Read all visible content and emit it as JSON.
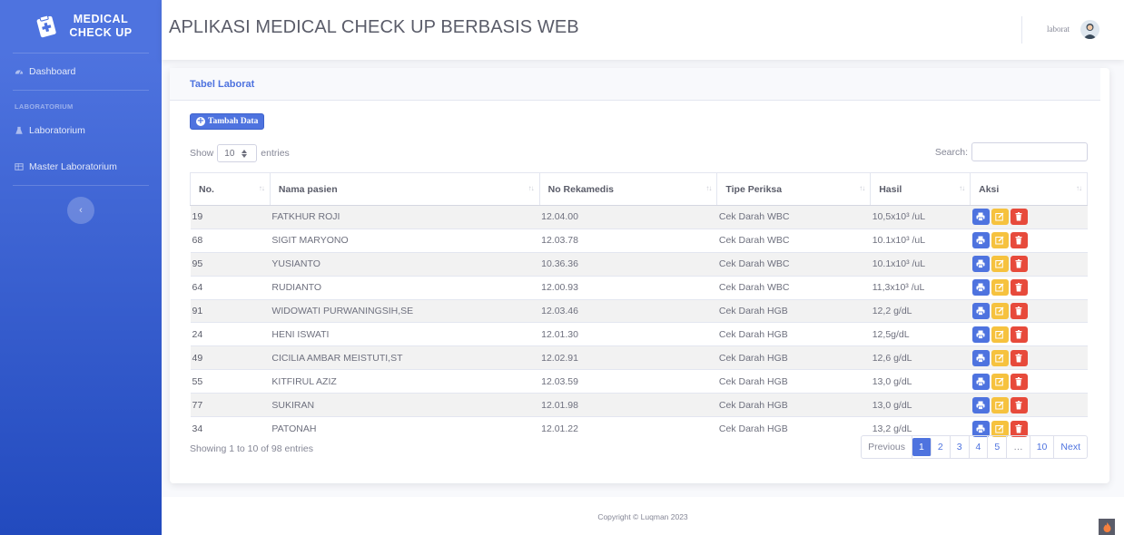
{
  "sidebar": {
    "brand_line1": "MEDICAL",
    "brand_line2": "CHECK UP",
    "dashboard_label": "Dashboard",
    "heading_laboratorium": "LABORATORIUM",
    "laboratorium_label": "Laboratorium",
    "master_label": "Master Laboratorium",
    "toggle_glyph": "‹"
  },
  "topbar": {
    "title": "APLIKASI MEDICAL CHECK UP BERBASIS WEB",
    "user_name": "laborat"
  },
  "card": {
    "title": "Tabel Laborat",
    "add_button": "Tambah Data",
    "show_label": "Show",
    "show_value": "10",
    "entries_label": "entries",
    "search_label": "Search:",
    "search_value": ""
  },
  "table": {
    "columns": [
      "No.",
      "Nama pasien",
      "No Rekamedis",
      "Tipe Periksa",
      "Hasil",
      "Aksi"
    ],
    "rows": [
      [
        "19",
        "FATKHUR ROJI",
        "12.04.00",
        "Cek Darah WBC",
        "10,5x10³ /uL"
      ],
      [
        "68",
        "SIGIT MARYONO",
        "12.03.78",
        "Cek Darah WBC",
        "10.1x10³ /uL"
      ],
      [
        "95",
        "YUSIANTO",
        "10.36.36",
        "Cek Darah WBC",
        "10.1x10³ /uL"
      ],
      [
        "64",
        "RUDIANTO",
        "12.00.93",
        "Cek Darah WBC",
        "11,3x10³ /uL"
      ],
      [
        "91",
        "WIDOWATI PURWANINGSIH,SE",
        "12.03.46",
        "Cek Darah HGB",
        "12,2 g/dL"
      ],
      [
        "24",
        "HENI ISWATI",
        "12.01.30",
        "Cek Darah HGB",
        "12,5g/dL"
      ],
      [
        "49",
        "CICILIA AMBAR MEISTUTI,ST",
        "12.02.91",
        "Cek Darah HGB",
        "12,6 g/dL"
      ],
      [
        "55",
        "KITFIRUL AZIZ",
        "12.03.59",
        "Cek Darah HGB",
        "13,0 g/dL"
      ],
      [
        "77",
        "SUKIRAN",
        "12.01.98",
        "Cek Darah HGB",
        "13,0 g/dL"
      ],
      [
        "34",
        "PATONAH",
        "12.01.22",
        "Cek Darah HGB",
        "13,2 g/dL"
      ]
    ]
  },
  "info": "Showing 1 to 10 of 98 entries",
  "pagination": {
    "previous": "Previous",
    "pages": [
      "1",
      "2",
      "3",
      "4",
      "5",
      "…",
      "10"
    ],
    "active_page": "1",
    "next": "Next"
  },
  "footer": "Copyright © Luqman 2023",
  "icons": {
    "brand": "notes-medical-icon",
    "dashboard": "tachometer-icon",
    "laboratorium": "flask-icon",
    "master": "table-icon",
    "add": "plus-circle-icon",
    "print": "print-icon",
    "edit": "edit-icon",
    "delete": "trash-icon",
    "scroll_top": "fire-icon"
  },
  "colors": {
    "primary": "#4e73df",
    "warning": "#f6c23e",
    "danger": "#e74a3b"
  }
}
